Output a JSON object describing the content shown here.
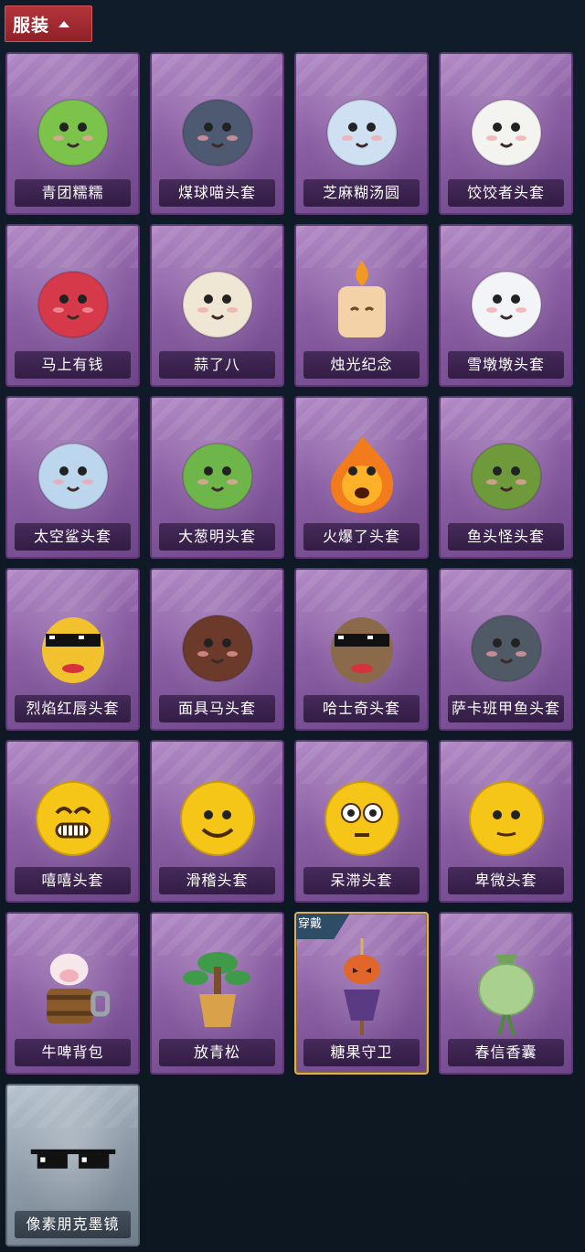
{
  "section": {
    "title": "服装"
  },
  "items": [
    {
      "label": "青团糯糯",
      "icon": "green-bun-headgear-icon",
      "color": "#7bc34a"
    },
    {
      "label": "煤球喵头套",
      "icon": "gray-cat-headgear-icon",
      "color": "#4d5a72"
    },
    {
      "label": "芝麻糊汤圆",
      "icon": "rice-ball-headgear-icon",
      "color": "#cfe0f2"
    },
    {
      "label": "饺饺者头套",
      "icon": "dumpling-headgear-icon",
      "color": "#f3f3f0"
    },
    {
      "label": "马上有钱",
      "icon": "red-horse-headgear-icon",
      "color": "#d6394a"
    },
    {
      "label": "蒜了八",
      "icon": "garlic-headgear-icon",
      "color": "#efe6d3"
    },
    {
      "label": "烛光纪念",
      "icon": "candle-headgear-icon",
      "color": "#f4d2a8"
    },
    {
      "label": "雪墩墩头套",
      "icon": "snowman-headgear-icon",
      "color": "#f2f4f8"
    },
    {
      "label": "太空鲨头套",
      "icon": "shark-headgear-icon",
      "color": "#bcd6ee"
    },
    {
      "label": "大葱明头套",
      "icon": "scallion-headgear-icon",
      "color": "#6fb64a"
    },
    {
      "label": "火爆了头套",
      "icon": "fire-headgear-icon",
      "color": "#f27b1c"
    },
    {
      "label": "鱼头怪头套",
      "icon": "fish-head-headgear-icon",
      "color": "#6f9a3c"
    },
    {
      "label": "烈焰红唇头套",
      "icon": "yellow-mouse-sunglasses-icon",
      "color": "#f2c12e"
    },
    {
      "label": "面具马头套",
      "icon": "horse-mask-icon",
      "color": "#6b3a2a"
    },
    {
      "label": "哈士奇头套",
      "icon": "husky-sunglasses-icon",
      "color": "#8a6a4a"
    },
    {
      "label": "萨卡班甲鱼头套",
      "icon": "armored-fish-headgear-icon",
      "color": "#505a66"
    },
    {
      "label": "嘻嘻头套",
      "icon": "grin-emoji-icon",
      "color": "#f5c518"
    },
    {
      "label": "滑稽头套",
      "icon": "funny-emoji-icon",
      "color": "#f5c518"
    },
    {
      "label": "呆滞头套",
      "icon": "dazed-emoji-icon",
      "color": "#f5c518"
    },
    {
      "label": "卑微头套",
      "icon": "humble-emoji-icon",
      "color": "#f5c518"
    },
    {
      "label": "牛啤背包",
      "icon": "cow-beer-backpack-icon",
      "color": "#8a5a2b"
    },
    {
      "label": "放青松",
      "icon": "bonsai-tree-icon",
      "color": "#3f9a4a"
    },
    {
      "label": "糖果守卫",
      "icon": "pumpkin-scarecrow-icon",
      "color": "#e0662a",
      "equipped": "穿戴"
    },
    {
      "label": "春信香囊",
      "icon": "green-sachet-icon",
      "color": "#a9d08f"
    },
    {
      "label": "像素朋克墨镜",
      "icon": "pixel-sunglasses-icon",
      "color": "#1b1b1b",
      "style": "gray"
    }
  ]
}
